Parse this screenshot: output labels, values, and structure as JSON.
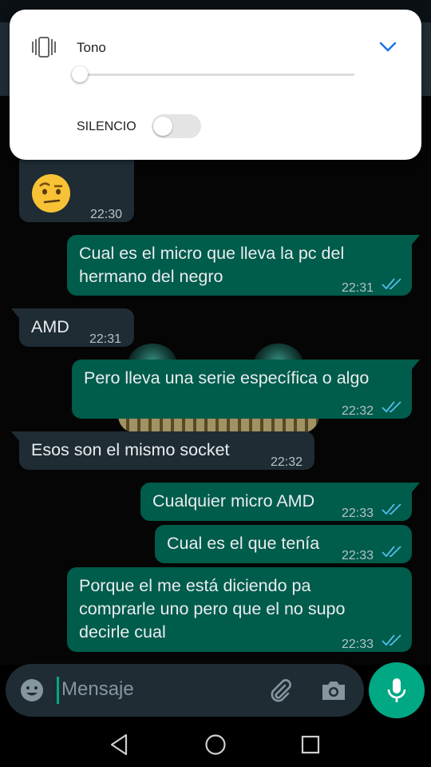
{
  "volume_panel": {
    "label": "Tono",
    "silence_label": "SILENCIO",
    "volume_level": 0,
    "silence_on": false
  },
  "messages": [
    {
      "dir": "in",
      "emoji": "face-with-raised-eyebrow",
      "time": "22:30"
    },
    {
      "dir": "out",
      "text": "Cual es el micro que lleva la pc del\nhermano del negro",
      "time": "22:31",
      "read": true
    },
    {
      "dir": "in",
      "text": "AMD",
      "time": "22:31"
    },
    {
      "dir": "out",
      "text": "Pero lleva una serie específica o algo",
      "time": "22:32",
      "read": true
    },
    {
      "dir": "in",
      "text": "Esos son el mismo socket",
      "time": "22:32"
    },
    {
      "dir": "out",
      "text": "Cualquier micro AMD",
      "time": "22:33",
      "read": true
    },
    {
      "dir": "out",
      "text": "Cual es el que tenía",
      "time": "22:33",
      "read": true
    },
    {
      "dir": "out",
      "text": "Porque el me está diciendo pa\ncomprarle uno pero que el no supo\ndecirle cual",
      "time": "22:33",
      "read": true
    }
  ],
  "composer": {
    "placeholder": "Mensaje"
  },
  "colors": {
    "outgoing": "#005c4b",
    "incoming": "#1f2c34",
    "accent": "#00a884",
    "read_ticks": "#53bdeb",
    "panel_accent": "#1a73e8"
  },
  "icons": [
    "vibrate-icon",
    "chevron-down-icon",
    "emoji-icon",
    "attach-icon",
    "camera-icon",
    "mic-icon",
    "nav-back-icon",
    "nav-home-icon",
    "nav-recent-icon"
  ]
}
